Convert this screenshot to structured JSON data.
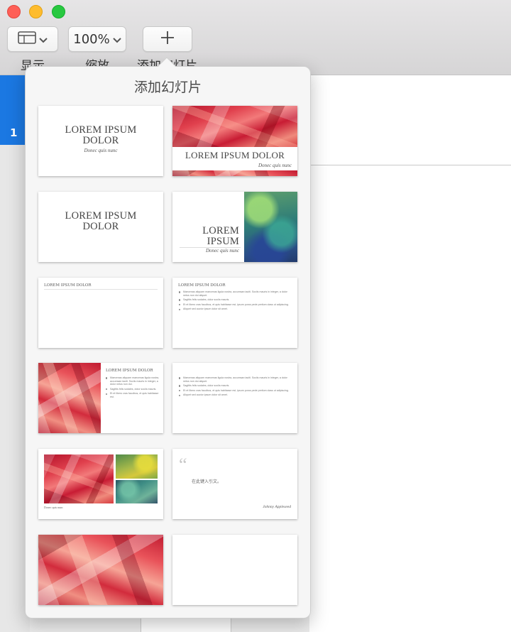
{
  "window": {
    "traffic_lights": [
      "close",
      "minimize",
      "zoom"
    ],
    "colors": {
      "accent": "#1b78e2",
      "close": "#fe5f57",
      "minimize": "#febc2e",
      "zoom": "#28c840"
    }
  },
  "toolbar": {
    "view": {
      "label": "显示",
      "icon": "sidebar-view-icon"
    },
    "zoom": {
      "value": "100%",
      "label": "缩放"
    },
    "add_slide": {
      "label": "添加幻灯片",
      "icon": "plus-icon"
    }
  },
  "navigator": {
    "selected_slide_number": "1"
  },
  "popover": {
    "title": "添加幻灯片",
    "layouts": {
      "title_center": {
        "title": "LOREM IPSUM DOLOR",
        "subtitle": "Donec quis nunc"
      },
      "photo_title_bottom": {
        "title": "LOREM IPSUM DOLOR",
        "subtitle": "Donec quis nunc"
      },
      "title_only": {
        "title": "LOREM IPSUM DOLOR"
      },
      "photo_right": {
        "title": "LOREM IPSUM",
        "subtitle": "Donec quis nunc"
      },
      "title_top": {
        "title": "LOREM IPSUM DOLOR"
      },
      "title_bullets": {
        "title": "LOREM IPSUM DOLOR",
        "bullets": [
          "Maecenas aliquam maecenas ligula nostra, accumsan taciti. Sociis mauris in integer, a dolor netus non dui aliquet.",
          "Sagittis felis sodales, dolor sociis mauris.",
          "Et et libero cras faucibus, et quis habitasse est, ipsum purus pede pretium class ut adipiscing.",
          "Aliquet sed auctor ipsum dolor sit amet."
        ]
      },
      "photo_bullets": {
        "title": "LOREM IPSUM DOLOR",
        "bullets": [
          "Maecenas aliquam maecenas ligula nostra, accumsan taciti. Sociis mauris in integer, a dolor netus non dui.",
          "Sagittis felis sodales, dolor sociis mauris.",
          "Et et libero cras faucibus, et quis habitasse est."
        ]
      },
      "bullets_only": {
        "bullets": [
          "Maecenas aliquam maecenas ligula nostra, accumsan taciti. Sociis mauris in integer, a dolor netus non dui aliquet.",
          "Sagittis felis sodales, dolor sociis mauris.",
          "Et et libero cras faucibus, et quis habitasse est, ipsum purus pede pretium class ut adipiscing.",
          "Aliquet sed auctor ipsum dolor sit amet."
        ]
      },
      "photo_three": {
        "caption": "Donec quis nunc"
      },
      "quote": {
        "quote_mark": "“",
        "text": "在此键入引文。",
        "attribution": "Johnny Appleseed"
      }
    }
  }
}
